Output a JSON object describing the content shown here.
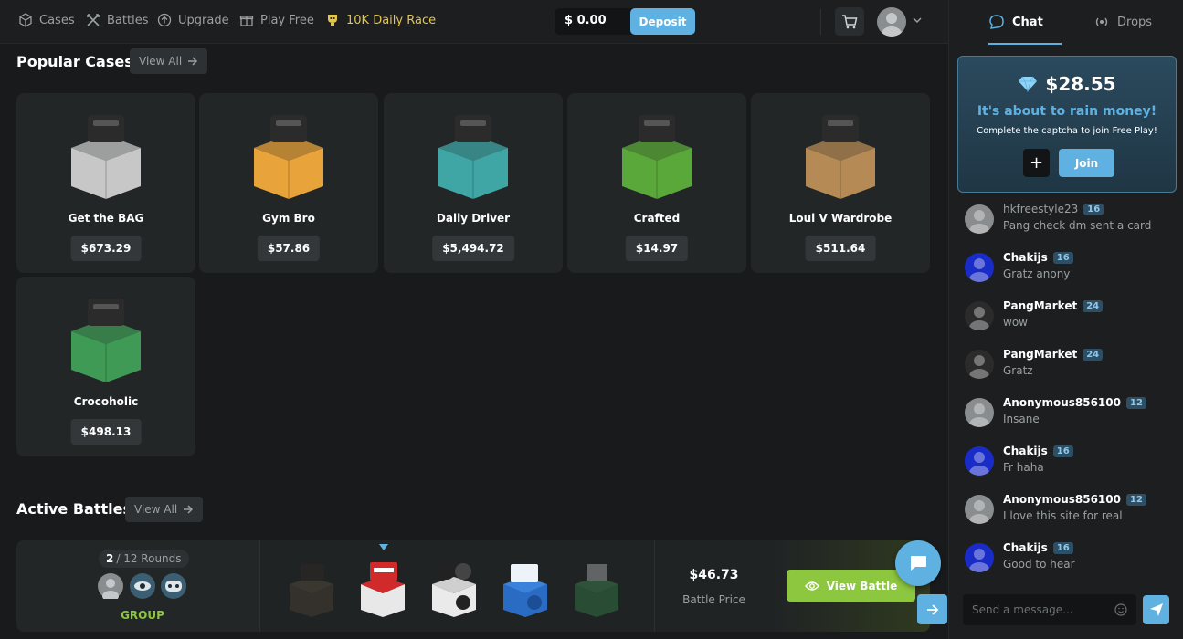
{
  "nav": {
    "items": [
      {
        "label": "Cases",
        "icon": "cube-icon"
      },
      {
        "label": "Battles",
        "icon": "swords-icon"
      },
      {
        "label": "Upgrade",
        "icon": "upgrade-icon"
      },
      {
        "label": "Play Free",
        "icon": "gift-icon"
      },
      {
        "label": "10K Daily Race",
        "icon": "trophy-icon"
      }
    ],
    "balance": "$ 0.00",
    "deposit_label": "Deposit"
  },
  "popular": {
    "title": "Popular Cases",
    "view_all": "View All",
    "cases": [
      {
        "name": "Get the BAG",
        "price": "$673.29",
        "color": "#c7c7c7"
      },
      {
        "name": "Gym Bro",
        "price": "$57.86",
        "color": "#e8a33a"
      },
      {
        "name": "Daily Driver",
        "price": "$5,494.72",
        "color": "#3fa6a5"
      },
      {
        "name": "Crafted",
        "price": "$14.97",
        "color": "#5ba83a"
      },
      {
        "name": "Loui V Wardrobe",
        "price": "$511.64",
        "color": "#b58a55"
      },
      {
        "name": "Crocoholic",
        "price": "$498.13",
        "color": "#3f9a55"
      }
    ]
  },
  "battles": {
    "title": "Active Battles",
    "view_all": "View All",
    "round_current": "2",
    "round_total": "/ 12 Rounds",
    "group_label": "GROUP",
    "price": "$46.73",
    "price_label": "Battle Price",
    "view_label": "View Battle"
  },
  "chat": {
    "tab_chat": "Chat",
    "tab_drops": "Drops",
    "rain_amount": "$28.55",
    "rain_title": "It's about to rain money!",
    "rain_sub": "Complete the captcha to join Free Play!",
    "join_label": "Join",
    "plus_label": "+",
    "messages": [
      {
        "user": "hkfreestyle23",
        "level": "16",
        "text": "Pang check dm sent a card"
      },
      {
        "user": "Chakijs",
        "level": "16",
        "text": "Gratz anony"
      },
      {
        "user": "PangMarket",
        "level": "24",
        "text": "wow"
      },
      {
        "user": "PangMarket",
        "level": "24",
        "text": "Gratz"
      },
      {
        "user": "Anonymous856100",
        "level": "12",
        "text": "Insane"
      },
      {
        "user": "Chakijs",
        "level": "16",
        "text": "Fr haha"
      },
      {
        "user": "Anonymous856100",
        "level": "12",
        "text": "I love this site for real"
      },
      {
        "user": "Chakijs",
        "level": "16",
        "text": "Good to hear"
      }
    ],
    "input_placeholder": "Send a message..."
  }
}
